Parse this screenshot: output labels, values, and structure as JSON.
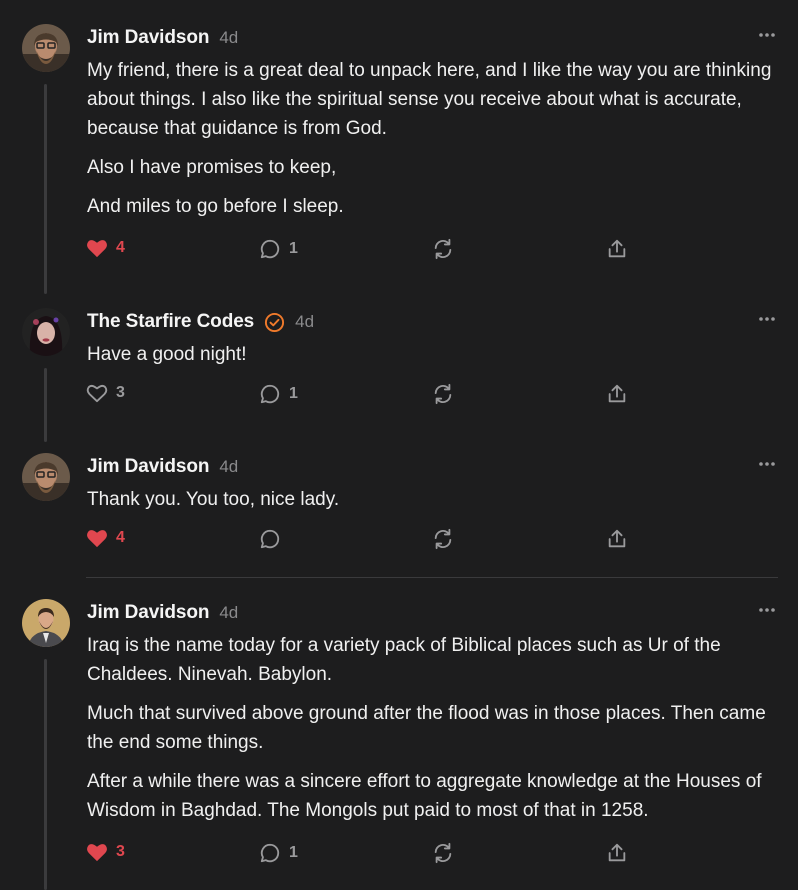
{
  "colors": {
    "background": "#1d1d1e",
    "text": "#f0f0f0",
    "muted": "#8a8a8c",
    "like_active": "#e0474f",
    "verified": "#f07a2b"
  },
  "comments": [
    {
      "author": "Jim Davidson",
      "time": "4d",
      "verified": false,
      "paragraphs": [
        "My friend, there is a great deal to unpack here, and I like the way you are thinking about things. I also like the spiritual sense you receive about what is accurate, because that guidance is from God.",
        "Also I have promises to keep,",
        "And miles to go before I sleep."
      ],
      "likes": "4",
      "liked": true,
      "replies": "1",
      "icons": [
        "heart-icon",
        "comment-icon",
        "restack-icon",
        "share-icon",
        "more-icon"
      ]
    },
    {
      "author": "The Starfire Codes",
      "time": "4d",
      "verified": true,
      "paragraphs": [
        "Have a good night!"
      ],
      "likes": "3",
      "liked": false,
      "replies": "1"
    },
    {
      "author": "Jim Davidson",
      "time": "4d",
      "verified": false,
      "paragraphs": [
        "Thank you. You too, nice lady."
      ],
      "likes": "4",
      "liked": true,
      "replies": ""
    },
    {
      "author": "Jim Davidson",
      "time": "4d",
      "verified": false,
      "paragraphs": [
        "Iraq is the name today for a variety pack of Biblical places such as Ur of the Chaldees. Ninevah. Babylon.",
        "Much that survived above ground after the flood was in those places. Then came the end some things.",
        "After a while there was a sincere effort to aggregate knowledge at the Houses of Wisdom in Baghdad. The Mongols put paid to most of that in 1258."
      ],
      "likes": "3",
      "liked": true,
      "replies": "1"
    }
  ]
}
